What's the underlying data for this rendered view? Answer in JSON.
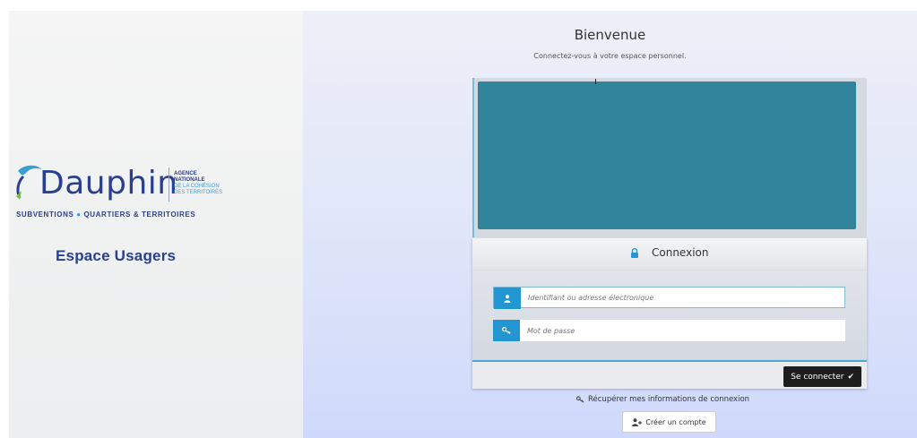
{
  "brand": {
    "name": "Dauphin",
    "agency": [
      "AGENCE",
      "NATIONALE",
      "DE LA COHÉSION",
      "DES TERRITOIRES"
    ],
    "tagline_left": "SUBVENTIONS",
    "tagline_right": "QUARTIERS & TERRITOIRES",
    "space": "Espace Usagers",
    "colors": {
      "primary": "#2a3f8f",
      "accent": "#3a9fd6"
    }
  },
  "header": {
    "title": "Bienvenue",
    "subtitle": "Connectez-vous à votre espace personnel."
  },
  "banner": {
    "color": "#31849b"
  },
  "login": {
    "title": "Connexion",
    "username_placeholder": "Identifiant ou adresse électronique",
    "password_placeholder": "Mot de passe",
    "submit_label": "Se connecter",
    "field_accent": "#2196d3"
  },
  "links": {
    "recover": "Récupérer mes informations de connexion",
    "create_account": "Créer un compte"
  }
}
